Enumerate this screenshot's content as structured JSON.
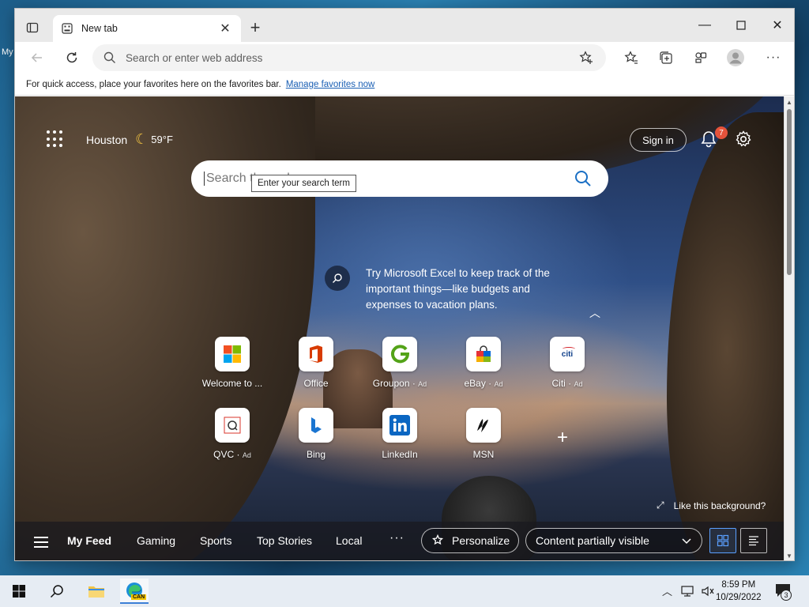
{
  "desktop": {
    "partial_label": "My"
  },
  "browser": {
    "tab": {
      "title": "New tab"
    },
    "address": {
      "placeholder": "Search or enter web address"
    },
    "favbar": {
      "message": "For quick access, place your favorites here on the favorites bar.",
      "link": "Manage favorites now"
    }
  },
  "newtab": {
    "weather": {
      "city": "Houston",
      "temp": "59°F",
      "icon": "moon-icon"
    },
    "signin": "Sign in",
    "notifications_count": "7",
    "search": {
      "placeholder": "Search the web",
      "tooltip": "Enter your search term"
    },
    "promo": "Try Microsoft Excel to keep track of the important things—like budgets and expenses to vacation plans.",
    "tiles": [
      {
        "label": "Welcome to ...",
        "ad": "",
        "icon": "microsoft-icon"
      },
      {
        "label": "Office",
        "ad": "",
        "icon": "office-icon"
      },
      {
        "label": "Groupon",
        "ad": "Ad",
        "icon": "groupon-icon"
      },
      {
        "label": "eBay",
        "ad": "Ad",
        "icon": "ebay-icon"
      },
      {
        "label": "Citi",
        "ad": "Ad",
        "icon": "citi-icon"
      },
      {
        "label": "QVC",
        "ad": "Ad",
        "icon": "qvc-icon"
      },
      {
        "label": "Bing",
        "ad": "",
        "icon": "bing-icon"
      },
      {
        "label": "LinkedIn",
        "ad": "",
        "icon": "linkedin-icon"
      },
      {
        "label": "MSN",
        "ad": "",
        "icon": "msn-icon"
      }
    ],
    "like_background": "Like this background?",
    "feed": {
      "tabs": [
        "My Feed",
        "Gaming",
        "Sports",
        "Top Stories",
        "Local"
      ],
      "more": "···",
      "personalize": "Personalize",
      "content_visibility": "Content partially visible"
    }
  },
  "taskbar": {
    "time": "8:59 PM",
    "date": "10/29/2022",
    "notification_count": "3",
    "edge_badge": "CAN"
  }
}
